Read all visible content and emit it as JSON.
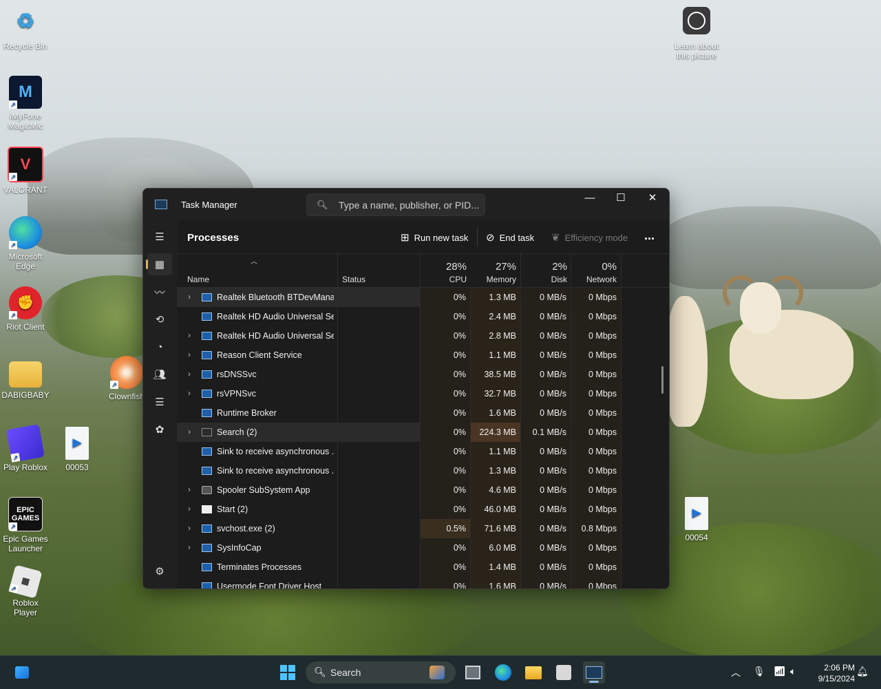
{
  "desktop": {
    "icons": [
      {
        "label": "Recycle Bin"
      },
      {
        "label": "iMyFone MagicMic"
      },
      {
        "label": "VALORANT"
      },
      {
        "label": "Microsoft Edge"
      },
      {
        "label": "Riot Client"
      },
      {
        "label": "DABIGBABY"
      },
      {
        "label": "Clownfish"
      },
      {
        "label": "Play Roblox"
      },
      {
        "label": "00053"
      },
      {
        "label": "Epic Games Launcher"
      },
      {
        "label": "Roblox Player"
      },
      {
        "label": "00054"
      },
      {
        "label": "Learn about this picture"
      }
    ]
  },
  "task_manager": {
    "title": "Task Manager",
    "search_placeholder": "Type a name, publisher, or PID...",
    "page_title": "Processes",
    "toolbar": {
      "run_new_task": "Run new task",
      "end_task": "End task",
      "efficiency_mode": "Efficiency mode",
      "more": "..."
    },
    "columns": {
      "name": "Name",
      "status": "Status",
      "cpu": {
        "pct": "28%",
        "label": "CPU"
      },
      "memory": {
        "pct": "27%",
        "label": "Memory"
      },
      "disk": {
        "pct": "2%",
        "label": "Disk"
      },
      "network": {
        "pct": "0%",
        "label": "Network"
      }
    },
    "rows": [
      {
        "name": "Realtek Bluetooth BTDevMana...",
        "cpu": "0%",
        "memory": "1.3 MB",
        "disk": "0 MB/s",
        "network": "0 Mbps"
      },
      {
        "name": "Realtek HD Audio Universal Se...",
        "cpu": "0%",
        "memory": "2.4 MB",
        "disk": "0 MB/s",
        "network": "0 Mbps"
      },
      {
        "name": "Realtek HD Audio Universal Se...",
        "cpu": "0%",
        "memory": "2.8 MB",
        "disk": "0 MB/s",
        "network": "0 Mbps"
      },
      {
        "name": "Reason Client Service",
        "cpu": "0%",
        "memory": "1.1 MB",
        "disk": "0 MB/s",
        "network": "0 Mbps"
      },
      {
        "name": "rsDNSSvc",
        "cpu": "0%",
        "memory": "38.5 MB",
        "disk": "0 MB/s",
        "network": "0 Mbps"
      },
      {
        "name": "rsVPNSvc",
        "cpu": "0%",
        "memory": "32.7 MB",
        "disk": "0 MB/s",
        "network": "0 Mbps"
      },
      {
        "name": "Runtime Broker",
        "cpu": "0%",
        "memory": "1.6 MB",
        "disk": "0 MB/s",
        "network": "0 Mbps"
      },
      {
        "name": "Search (2)",
        "cpu": "0%",
        "memory": "224.3 MB",
        "disk": "0.1 MB/s",
        "network": "0 Mbps"
      },
      {
        "name": "Sink to receive asynchronous ...",
        "cpu": "0%",
        "memory": "1.1 MB",
        "disk": "0 MB/s",
        "network": "0 Mbps"
      },
      {
        "name": "Sink to receive asynchronous ...",
        "cpu": "0%",
        "memory": "1.3 MB",
        "disk": "0 MB/s",
        "network": "0 Mbps"
      },
      {
        "name": "Spooler SubSystem App",
        "cpu": "0%",
        "memory": "4.6 MB",
        "disk": "0 MB/s",
        "network": "0 Mbps"
      },
      {
        "name": "Start (2)",
        "cpu": "0%",
        "memory": "46.0 MB",
        "disk": "0 MB/s",
        "network": "0 Mbps"
      },
      {
        "name": "svchost.exe (2)",
        "cpu": "0.5%",
        "memory": "71.6 MB",
        "disk": "0 MB/s",
        "network": "0.8 Mbps"
      },
      {
        "name": "SysInfoCap",
        "cpu": "0%",
        "memory": "6.0 MB",
        "disk": "0 MB/s",
        "network": "0 Mbps"
      },
      {
        "name": "Terminates Processes",
        "cpu": "0%",
        "memory": "1.4 MB",
        "disk": "0 MB/s",
        "network": "0 Mbps"
      },
      {
        "name": "Usermode Font Driver Host",
        "cpu": "0%",
        "memory": "1.6 MB",
        "disk": "0 MB/s",
        "network": "0 Mbps"
      }
    ]
  },
  "taskbar": {
    "search_label": "Search",
    "time": "2:06 PM",
    "date": "9/15/2024"
  }
}
